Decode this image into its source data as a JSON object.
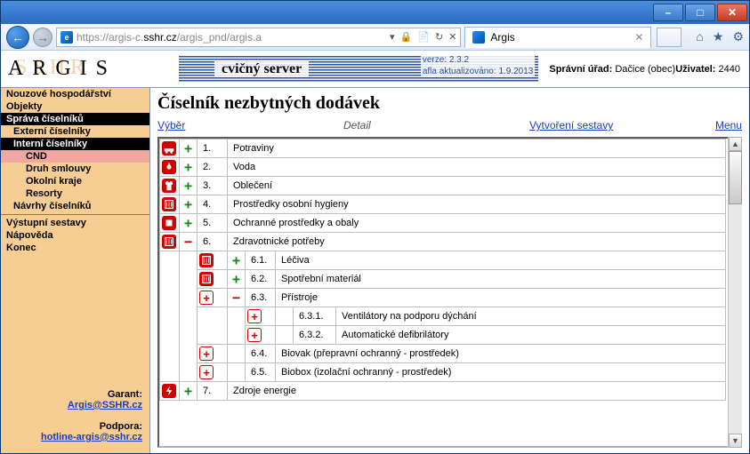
{
  "browser": {
    "url_prefix": "https://argis-c.",
    "url_bold": "sshr.cz",
    "url_suffix": "/argis_pnd/argis.a",
    "tab_title": "Argis"
  },
  "app": {
    "logo_main": "ARGIS",
    "logo_shadow": "SSHR",
    "cvicny_label": "cvičný server",
    "version_label": "verze:",
    "version_value": "2.3.2",
    "updated_label": "afla aktualizováno:",
    "updated_value": "1.9.2013",
    "admin_label": "Správní úřad:",
    "admin_value": "Dačice (obec)",
    "user_label": "Uživatel:",
    "user_value": "2440"
  },
  "sidebar": {
    "nouzove": "Nouzové hospodářství",
    "objekty": "Objekty",
    "sprava": "Správa číselníků",
    "externi": "Externí číselníky",
    "interni": "Interní číselníky",
    "cnd": "CND",
    "druh": "Druh smlouvy",
    "okolni": "Okolní kraje",
    "resorty": "Resorty",
    "navrhy": "Návrhy číselníků",
    "vystupni": "Výstupní sestavy",
    "napoveda": "Nápověda",
    "konec": "Konec",
    "garant_label": "Garant:",
    "garant_link": "Argis@SSHR.cz",
    "podpora_label": "Podpora:",
    "podpora_link": "hotline-argis@sshr.cz"
  },
  "main": {
    "title": "Číselník nezbytných dodávek",
    "tab_vyber": "Výběr",
    "tab_detail": "Detail",
    "tab_vytvoreni": "Vytvoření sestavy",
    "menu": "Menu"
  },
  "tree": {
    "r1": {
      "num": "1.",
      "txt": "Potraviny"
    },
    "r2": {
      "num": "2.",
      "txt": "Voda"
    },
    "r3": {
      "num": "3.",
      "txt": "Oblečení"
    },
    "r4": {
      "num": "4.",
      "txt": "Prostředky osobní hygieny"
    },
    "r5": {
      "num": "5.",
      "txt": "Ochranné prostředky a obaly"
    },
    "r6": {
      "num": "6.",
      "txt": "Zdravotnické potřeby"
    },
    "r61": {
      "num": "6.1.",
      "txt": "Léčiva"
    },
    "r62": {
      "num": "6.2.",
      "txt": "Spotřební materiál"
    },
    "r63": {
      "num": "6.3.",
      "txt": "Přístroje"
    },
    "r631": {
      "num": "6.3.1.",
      "txt": "Ventilátory na podporu dýchání"
    },
    "r632": {
      "num": "6.3.2.",
      "txt": "Automatické defibrilátory"
    },
    "r64": {
      "num": "6.4.",
      "txt": "Biovak (přepravní ochranný - prostředek)"
    },
    "r65": {
      "num": "6.5.",
      "txt": "Biobox (izolační ochranný - prostředek)"
    },
    "r7": {
      "num": "7.",
      "txt": "Zdroje energie"
    }
  }
}
